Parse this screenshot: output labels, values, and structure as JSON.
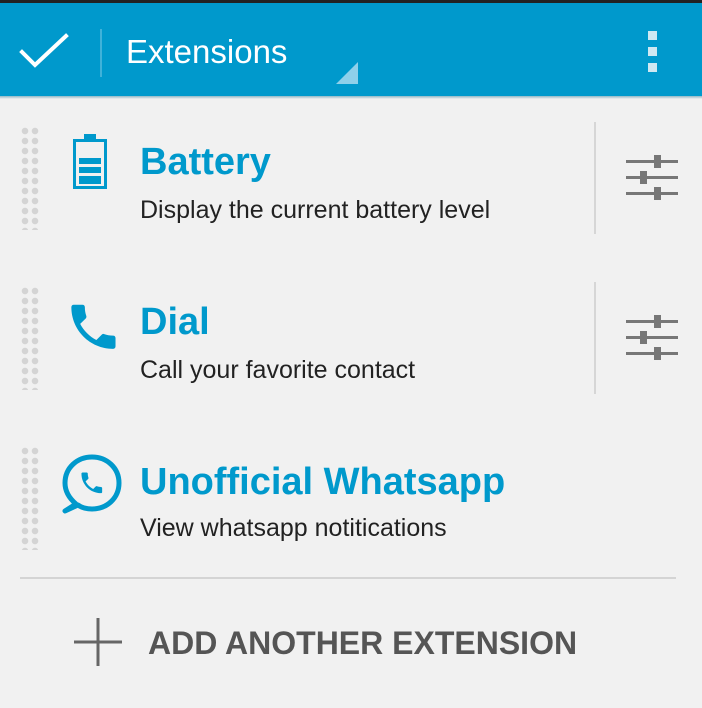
{
  "theme": {
    "accent": "#0099cc",
    "action_bar_bg": "#0099cc",
    "background": "#f1f1f1",
    "title_color": "#0099cc",
    "text_color": "#222222",
    "muted_color": "#555555"
  },
  "action_bar": {
    "done_icon": "check-icon",
    "spinner_label": "Extensions",
    "overflow_icon": "overflow-menu-icon"
  },
  "extensions": [
    {
      "icon": "battery-icon",
      "title": "Battery",
      "description": "Display the current battery level",
      "has_settings": true
    },
    {
      "icon": "phone-icon",
      "title": "Dial",
      "description": "Call your favorite contact",
      "has_settings": true
    },
    {
      "icon": "whatsapp-icon",
      "title": "Unofficial Whatsapp",
      "description": "View whatsapp notitications",
      "has_settings": false
    }
  ],
  "add_button": {
    "icon": "plus-icon",
    "label": "ADD ANOTHER EXTENSION"
  }
}
